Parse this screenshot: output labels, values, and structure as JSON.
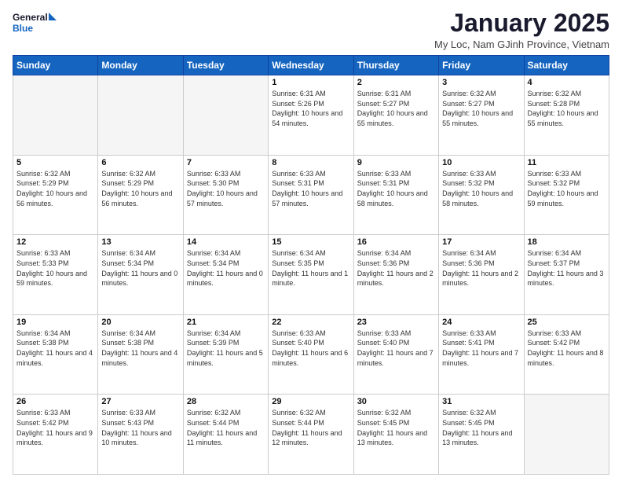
{
  "header": {
    "logo_line1": "General",
    "logo_line2": "Blue",
    "title": "January 2025",
    "subtitle": "My Loc, Nam GJinh Province, Vietnam"
  },
  "days": [
    "Sunday",
    "Monday",
    "Tuesday",
    "Wednesday",
    "Thursday",
    "Friday",
    "Saturday"
  ],
  "weeks": [
    [
      {
        "date": "",
        "empty": true
      },
      {
        "date": "",
        "empty": true
      },
      {
        "date": "",
        "empty": true
      },
      {
        "date": "1",
        "sunrise": "Sunrise: 6:31 AM",
        "sunset": "Sunset: 5:26 PM",
        "daylight": "Daylight: 10 hours and 54 minutes."
      },
      {
        "date": "2",
        "sunrise": "Sunrise: 6:31 AM",
        "sunset": "Sunset: 5:27 PM",
        "daylight": "Daylight: 10 hours and 55 minutes."
      },
      {
        "date": "3",
        "sunrise": "Sunrise: 6:32 AM",
        "sunset": "Sunset: 5:27 PM",
        "daylight": "Daylight: 10 hours and 55 minutes."
      },
      {
        "date": "4",
        "sunrise": "Sunrise: 6:32 AM",
        "sunset": "Sunset: 5:28 PM",
        "daylight": "Daylight: 10 hours and 55 minutes."
      }
    ],
    [
      {
        "date": "5",
        "sunrise": "Sunrise: 6:32 AM",
        "sunset": "Sunset: 5:29 PM",
        "daylight": "Daylight: 10 hours and 56 minutes."
      },
      {
        "date": "6",
        "sunrise": "Sunrise: 6:32 AM",
        "sunset": "Sunset: 5:29 PM",
        "daylight": "Daylight: 10 hours and 56 minutes."
      },
      {
        "date": "7",
        "sunrise": "Sunrise: 6:33 AM",
        "sunset": "Sunset: 5:30 PM",
        "daylight": "Daylight: 10 hours and 57 minutes."
      },
      {
        "date": "8",
        "sunrise": "Sunrise: 6:33 AM",
        "sunset": "Sunset: 5:31 PM",
        "daylight": "Daylight: 10 hours and 57 minutes."
      },
      {
        "date": "9",
        "sunrise": "Sunrise: 6:33 AM",
        "sunset": "Sunset: 5:31 PM",
        "daylight": "Daylight: 10 hours and 58 minutes."
      },
      {
        "date": "10",
        "sunrise": "Sunrise: 6:33 AM",
        "sunset": "Sunset: 5:32 PM",
        "daylight": "Daylight: 10 hours and 58 minutes."
      },
      {
        "date": "11",
        "sunrise": "Sunrise: 6:33 AM",
        "sunset": "Sunset: 5:32 PM",
        "daylight": "Daylight: 10 hours and 59 minutes."
      }
    ],
    [
      {
        "date": "12",
        "sunrise": "Sunrise: 6:33 AM",
        "sunset": "Sunset: 5:33 PM",
        "daylight": "Daylight: 10 hours and 59 minutes."
      },
      {
        "date": "13",
        "sunrise": "Sunrise: 6:34 AM",
        "sunset": "Sunset: 5:34 PM",
        "daylight": "Daylight: 11 hours and 0 minutes."
      },
      {
        "date": "14",
        "sunrise": "Sunrise: 6:34 AM",
        "sunset": "Sunset: 5:34 PM",
        "daylight": "Daylight: 11 hours and 0 minutes."
      },
      {
        "date": "15",
        "sunrise": "Sunrise: 6:34 AM",
        "sunset": "Sunset: 5:35 PM",
        "daylight": "Daylight: 11 hours and 1 minute."
      },
      {
        "date": "16",
        "sunrise": "Sunrise: 6:34 AM",
        "sunset": "Sunset: 5:36 PM",
        "daylight": "Daylight: 11 hours and 2 minutes."
      },
      {
        "date": "17",
        "sunrise": "Sunrise: 6:34 AM",
        "sunset": "Sunset: 5:36 PM",
        "daylight": "Daylight: 11 hours and 2 minutes."
      },
      {
        "date": "18",
        "sunrise": "Sunrise: 6:34 AM",
        "sunset": "Sunset: 5:37 PM",
        "daylight": "Daylight: 11 hours and 3 minutes."
      }
    ],
    [
      {
        "date": "19",
        "sunrise": "Sunrise: 6:34 AM",
        "sunset": "Sunset: 5:38 PM",
        "daylight": "Daylight: 11 hours and 4 minutes."
      },
      {
        "date": "20",
        "sunrise": "Sunrise: 6:34 AM",
        "sunset": "Sunset: 5:38 PM",
        "daylight": "Daylight: 11 hours and 4 minutes."
      },
      {
        "date": "21",
        "sunrise": "Sunrise: 6:34 AM",
        "sunset": "Sunset: 5:39 PM",
        "daylight": "Daylight: 11 hours and 5 minutes."
      },
      {
        "date": "22",
        "sunrise": "Sunrise: 6:33 AM",
        "sunset": "Sunset: 5:40 PM",
        "daylight": "Daylight: 11 hours and 6 minutes."
      },
      {
        "date": "23",
        "sunrise": "Sunrise: 6:33 AM",
        "sunset": "Sunset: 5:40 PM",
        "daylight": "Daylight: 11 hours and 7 minutes."
      },
      {
        "date": "24",
        "sunrise": "Sunrise: 6:33 AM",
        "sunset": "Sunset: 5:41 PM",
        "daylight": "Daylight: 11 hours and 7 minutes."
      },
      {
        "date": "25",
        "sunrise": "Sunrise: 6:33 AM",
        "sunset": "Sunset: 5:42 PM",
        "daylight": "Daylight: 11 hours and 8 minutes."
      }
    ],
    [
      {
        "date": "26",
        "sunrise": "Sunrise: 6:33 AM",
        "sunset": "Sunset: 5:42 PM",
        "daylight": "Daylight: 11 hours and 9 minutes."
      },
      {
        "date": "27",
        "sunrise": "Sunrise: 6:33 AM",
        "sunset": "Sunset: 5:43 PM",
        "daylight": "Daylight: 11 hours and 10 minutes."
      },
      {
        "date": "28",
        "sunrise": "Sunrise: 6:32 AM",
        "sunset": "Sunset: 5:44 PM",
        "daylight": "Daylight: 11 hours and 11 minutes."
      },
      {
        "date": "29",
        "sunrise": "Sunrise: 6:32 AM",
        "sunset": "Sunset: 5:44 PM",
        "daylight": "Daylight: 11 hours and 12 minutes."
      },
      {
        "date": "30",
        "sunrise": "Sunrise: 6:32 AM",
        "sunset": "Sunset: 5:45 PM",
        "daylight": "Daylight: 11 hours and 13 minutes."
      },
      {
        "date": "31",
        "sunrise": "Sunrise: 6:32 AM",
        "sunset": "Sunset: 5:45 PM",
        "daylight": "Daylight: 11 hours and 13 minutes."
      },
      {
        "date": "",
        "empty": true
      }
    ]
  ]
}
